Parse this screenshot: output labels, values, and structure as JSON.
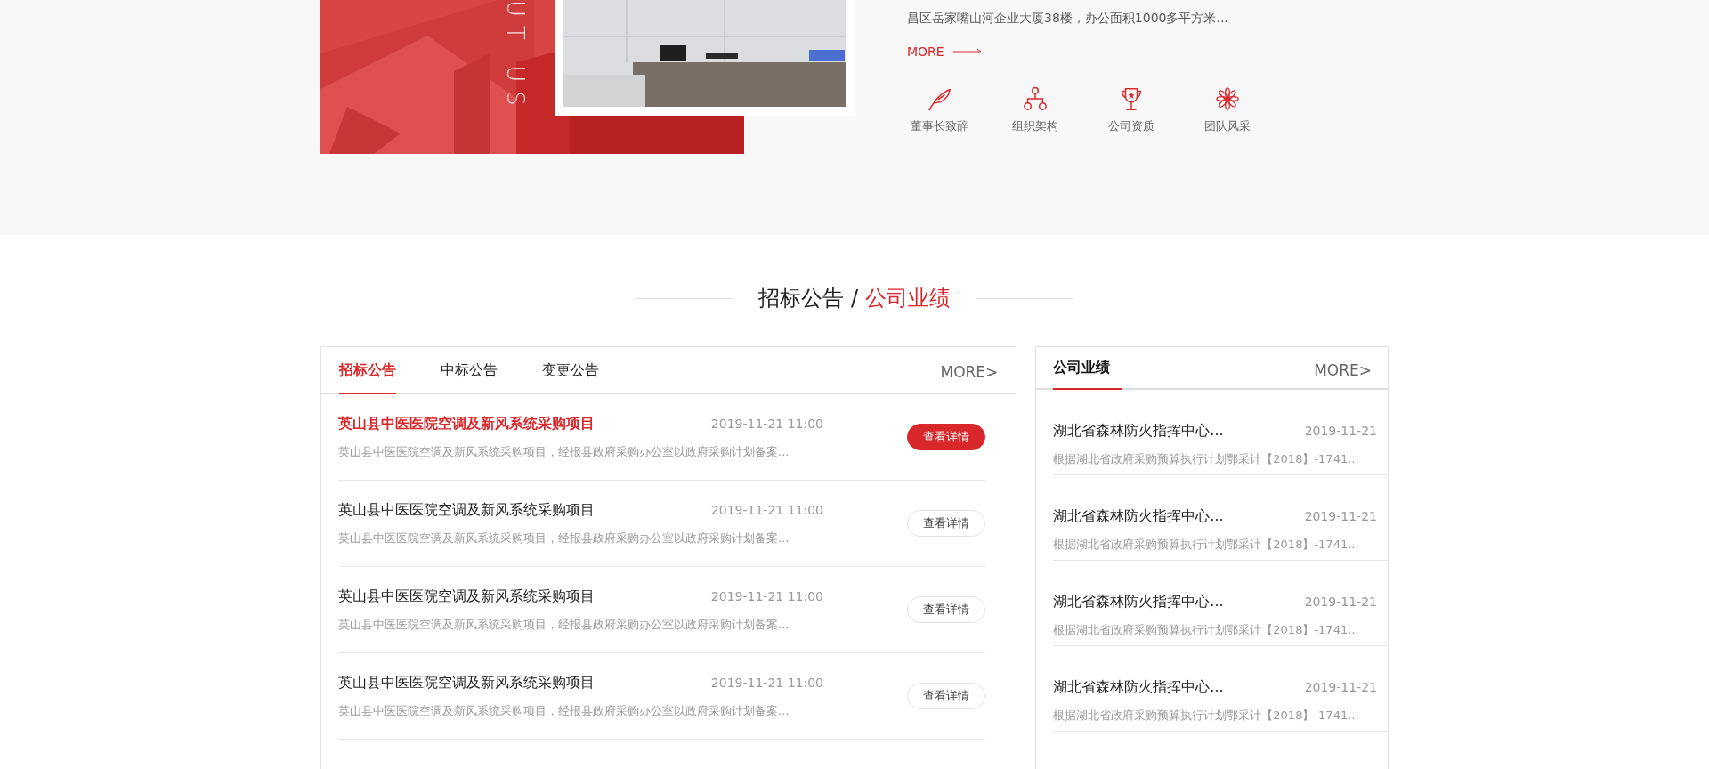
{
  "about": {
    "vertical_text": "UT US",
    "text": "昌区岳家嘴山河企业大厦38楼，办公面积1000多平方米...",
    "more": "MORE",
    "links": [
      {
        "kind": "quill",
        "label": "董事长致辞"
      },
      {
        "kind": "org",
        "label": "组织架构"
      },
      {
        "kind": "trophy",
        "label": "公司资质"
      },
      {
        "kind": "flower",
        "label": "团队风采"
      }
    ]
  },
  "section_title": {
    "main": "招标公告",
    "separator": "/",
    "accent": "公司业绩"
  },
  "notices": {
    "tabs": [
      {
        "label": "招标公告",
        "selected": true
      },
      {
        "label": "中标公告",
        "selected": false
      },
      {
        "label": "变更公告",
        "selected": false
      }
    ],
    "more": "MORE>",
    "items": [
      {
        "highlighted": true,
        "title": "英山县中医医院空调及新风系统采购项目",
        "date": "2019-11-21 11:00",
        "summary": "英山县中医医院空调及新风系统采购项目，经报县政府采购办公室以政府采购计划备案...",
        "button": "查看详情"
      },
      {
        "highlighted": false,
        "title": "英山县中医医院空调及新风系统采购项目",
        "date": "2019-11-21 11:00",
        "summary": "英山县中医医院空调及新风系统采购项目，经报县政府采购办公室以政府采购计划备案...",
        "button": "查看详情"
      },
      {
        "highlighted": false,
        "title": "英山县中医医院空调及新风系统采购项目",
        "date": "2019-11-21 11:00",
        "summary": "英山县中医医院空调及新风系统采购项目，经报县政府采购办公室以政府采购计划备案...",
        "button": "查看详情"
      },
      {
        "highlighted": false,
        "title": "英山县中医医院空调及新风系统采购项目",
        "date": "2019-11-21 11:00",
        "summary": "英山县中医医院空调及新风系统采购项目，经报县政府采购办公室以政府采购计划备案...",
        "button": "查看详情"
      }
    ]
  },
  "achievements": {
    "tab": "公司业绩",
    "more": "MORE>",
    "items": [
      {
        "title": "湖北省森林防火指挥中心...",
        "date": "2019-11-21",
        "summary": "根据湖北省政府采购预算执行计划鄂采计【2018】-1741..."
      },
      {
        "title": "湖北省森林防火指挥中心...",
        "date": "2019-11-21",
        "summary": "根据湖北省政府采购预算执行计划鄂采计【2018】-1741..."
      },
      {
        "title": "湖北省森林防火指挥中心...",
        "date": "2019-11-21",
        "summary": "根据湖北省政府采购预算执行计划鄂采计【2018】-1741..."
      },
      {
        "title": "湖北省森林防火指挥中心...",
        "date": "2019-11-21",
        "summary": "根据湖北省政府采购预算执行计划鄂采计【2018】-1741..."
      }
    ]
  }
}
